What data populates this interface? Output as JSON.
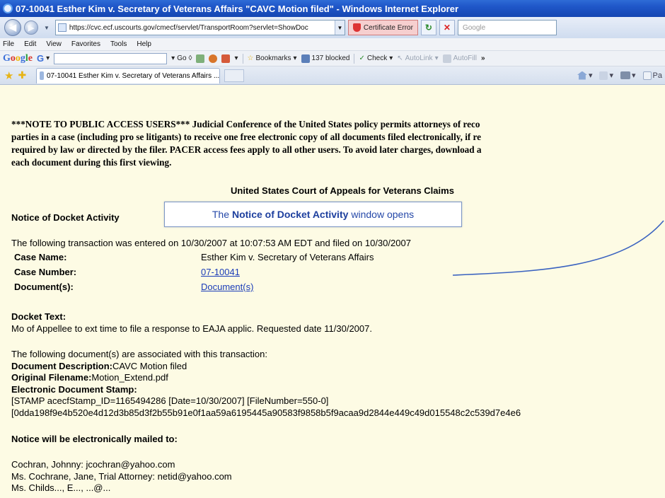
{
  "window": {
    "title": "07-10041 Esther Kim v. Secretary of Veterans Affairs \"CAVC Motion filed\" - Windows Internet Explorer"
  },
  "address_bar": {
    "url": "https://cvc.ecf.uscourts.gov/cmecf/servlet/TransportRoom?servlet=ShowDoc",
    "certificate_label": "Certificate Error",
    "search_placeholder": "Google"
  },
  "menu": [
    "File",
    "Edit",
    "View",
    "Favorites",
    "Tools",
    "Help"
  ],
  "google_toolbar": {
    "go_label": "Go",
    "bookmarks_label": "Bookmarks",
    "blocked_label": "137 blocked",
    "check_label": "Check",
    "autolink_label": "AutoLink",
    "autofill_label": "AutoFill",
    "more_label": "»"
  },
  "tab": {
    "title": "07-10041 Esther Kim v. Secretary of Veterans Affairs ..."
  },
  "tab_tools": {
    "page_label": "Pa"
  },
  "page": {
    "notice_lines": [
      "***NOTE TO PUBLIC ACCESS USERS*** Judicial Conference of the United States policy permits attorneys of reco",
      "parties in a case (including pro se litigants) to receive one free electronic copy of all documents filed electronically, if re",
      "required by law or directed by the filer. PACER access fees apply to all other users. To avoid later charges, download a",
      "each document during this first viewing."
    ],
    "court_name": "United States Court of Appeals for Veterans Claims",
    "notice_heading": "Notice of Docket Activity",
    "callout": {
      "prefix": "The ",
      "strong": "Notice of Docket Activity",
      "suffix": " window opens"
    },
    "transaction_line": "The following transaction was entered on 10/30/2007 at 10:07:53 AM EDT and filed on 10/30/2007",
    "case_name_label": "Case Name:",
    "case_name_value": "Esther Kim v. Secretary of Veterans Affairs",
    "case_number_label": "Case Number:",
    "case_number_value": "07-10041",
    "documents_label": "Document(s):",
    "documents_value": "Document(s)",
    "docket_text_label": "Docket Text:",
    "docket_text": "Mo of Appellee to ext time to file a response to EAJA applic. Requested date 11/30/2007.",
    "associated_line": "The following document(s) are associated with this transaction:",
    "doc_desc_label": "Document Description:",
    "doc_desc_value": "CAVC Motion filed",
    "orig_filename_label": "Original Filename:",
    "orig_filename_value": "Motion_Extend.pdf",
    "stamp_label": "Electronic Document Stamp:",
    "stamp_line1": "[STAMP acecfStamp_ID=1165494286 [Date=10/30/2007] [FileNumber=550-0]",
    "stamp_line2": "[0dda198f9e4b520e4d12d3b85d3f2b55b91e0f1aa59a6195445a90583f9858b5f9acaa9d2844e449c49d015548c2c539d7e4e6",
    "mailed_heading": "Notice will be electronically mailed to:",
    "recipients": [
      "Cochran, Johnny: jcochran@yahoo.com",
      "Ms. Cochrane, Jane, Trial Attorney: netid@yahoo.com",
      "Ms. Childs..., E..., ...@..."
    ]
  },
  "colors": {
    "page_background": "#fdfbe4",
    "link": "#1a3cb8",
    "callout_text": "#2548a8",
    "titlebar": "#1f56c8"
  }
}
